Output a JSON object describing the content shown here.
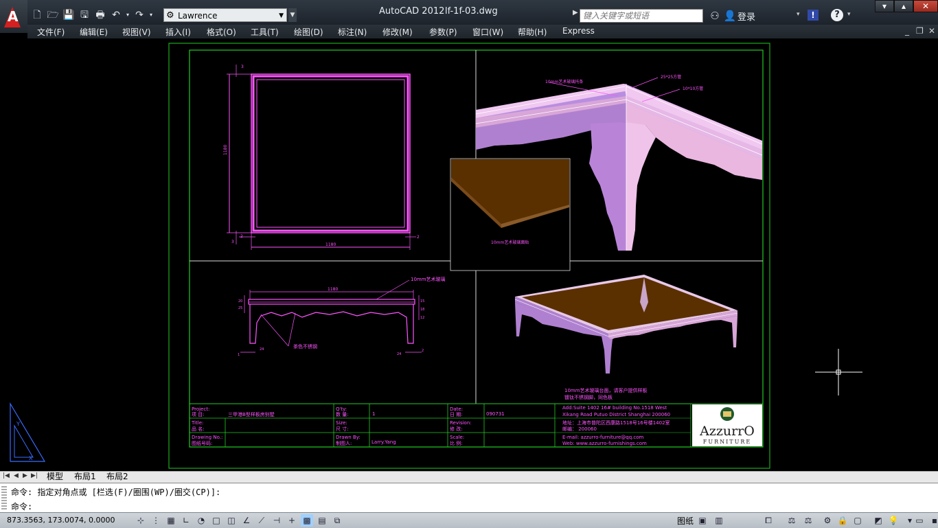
{
  "window": {
    "app_title": "AutoCAD 2012",
    "file_name": "lf-1f-03.dwg",
    "workspace": "Lawrence",
    "search_placeholder": "键入关键字或短语",
    "login_label": "登录"
  },
  "menu": {
    "items": [
      "文件(F)",
      "编辑(E)",
      "视图(V)",
      "插入(I)",
      "格式(O)",
      "工具(T)",
      "绘图(D)",
      "标注(N)",
      "修改(M)",
      "参数(P)",
      "窗口(W)",
      "帮助(H)",
      "Express"
    ]
  },
  "drawing": {
    "dims": {
      "top_small": "3",
      "height_side": "1180",
      "bottom_left": "2",
      "bottom_right": "2",
      "bottom_left_low": "3",
      "width_bottom": "1180",
      "front_width": "1180",
      "front_left_a": "20",
      "front_left_b": "25",
      "front_right_a": "15",
      "front_right_b": "18",
      "front_right_c": "12",
      "front_foot_l1": "1",
      "front_foot_l2": "24",
      "front_foot_r1": "24",
      "front_foot_r2": "2"
    },
    "annotations": {
      "glass_top": "10mm艺术玻璃",
      "legs_label": "茶色不锈钢",
      "glass_tray": "10mm艺术玻璃托条",
      "glass_panel": "10mm艺术玻璃面贴",
      "tube_25": "25*25方管",
      "tube_10": "10*10方管",
      "note_line1": "10mm艺术玻璃台面，请客户提供样板",
      "note_line2": "镀钛不锈钢脚，同色板"
    },
    "title_block": {
      "project_label_en": "Project:",
      "project_label_cn": "项  目:",
      "project_value": "三甲港B型样板房别墅",
      "title_label_en": "Title:",
      "title_label_cn": "品  名:",
      "drawing_no_label_en": "Drawing No.:",
      "drawing_no_label_cn": "图纸号码:",
      "qty_label_en": "Q'ty:",
      "qty_label_cn": "数  量:",
      "qty_value": "1",
      "size_label_en": "Size:",
      "size_label_cn": "尺  寸:",
      "drawn_by_label_en": "Drawn By:",
      "drawn_by_label_cn": "制图人:",
      "drawn_by_value": "Larry.Yang",
      "date_label_en": "Date:",
      "date_label_cn": "日  期:",
      "date_value": "090731",
      "revision_label_en": "Revision:",
      "revision_label_cn": "修  改:",
      "scale_label_en": "Scale:",
      "scale_label_cn": "比  例:",
      "address_en_1": "Add:Suite 1402 16# building No.1518 West",
      "address_en_2": "Xikang Road Putuo District Shanghai 200060",
      "address_cn": "地址：上海市普陀区西康路1518号16号楼1402室",
      "postcode": "邮编： 200060",
      "email": "E-mail: azzurro-furniture@qq.com",
      "web": "Web: www.azzurro-furnishings.com",
      "logo_text": "AzzurrO",
      "logo_sub": "FURNITURE"
    }
  },
  "layout_tabs": [
    "模型",
    "布局1",
    "布局2"
  ],
  "command": {
    "history": "命令: 指定对角点或 [栏选(F)/圈围(WP)/圈交(CP)]:",
    "prompt": "命令:"
  },
  "status": {
    "coordinates": "873.3563, 173.0074, 0.0000",
    "layout_label": "图纸"
  },
  "colors": {
    "magenta": "#ff33ff",
    "green_frame": "#22cc22",
    "glass_brown": "#5a3000",
    "leg_pink": "#d8a6d8",
    "leg_purple": "#b07fcf"
  }
}
